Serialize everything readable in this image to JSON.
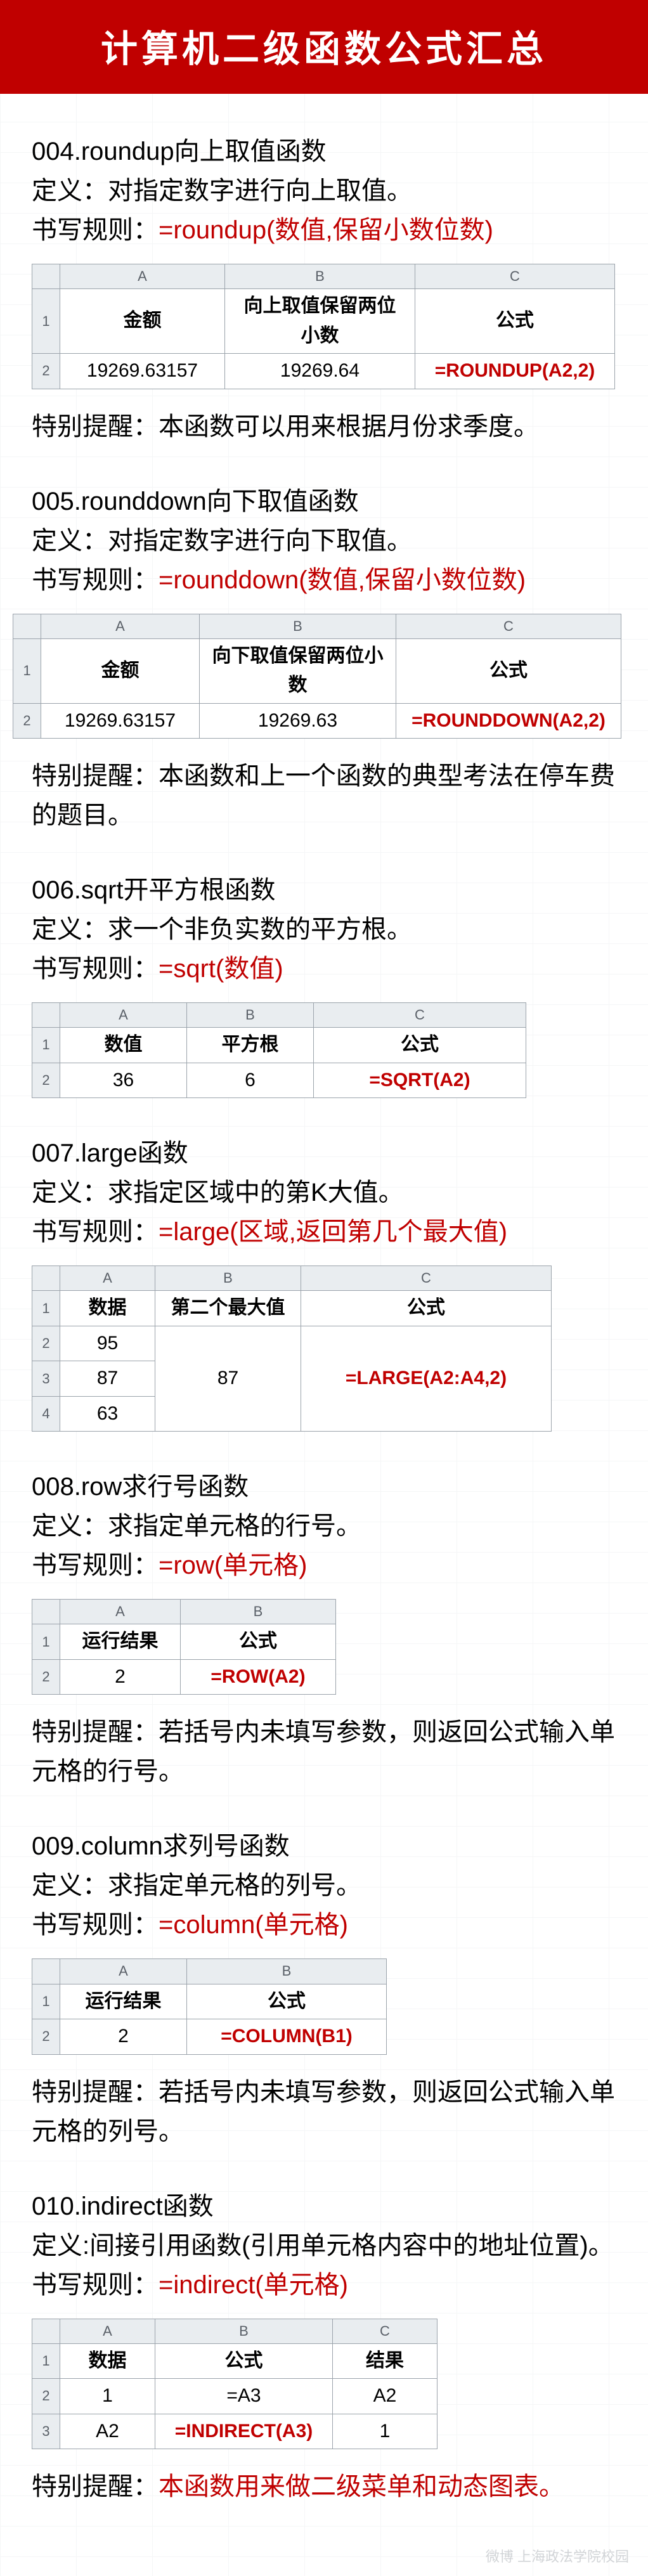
{
  "title": "计算机二级函数公式汇总",
  "watermark": "微博 上海政法学院校园",
  "sections": {
    "s004": {
      "heading": "004.roundup向上取值函数",
      "definition": "定义：对指定数字进行向上取值。",
      "syntax_label": "书写规则：",
      "syntax_formula": "=roundup(数值,保留小数位数)",
      "table_cols": [
        "A",
        "B",
        "C"
      ],
      "header": [
        "金额",
        "向上取值保留两位小数",
        "公式"
      ],
      "row": [
        "19269.63157",
        "19269.64",
        "=ROUNDUP(A2,2)"
      ],
      "tip_label": "特别提醒：",
      "tip_text": "本函数可以用来根据月份求季度。"
    },
    "s005": {
      "heading": "005.rounddown向下取值函数",
      "definition": "定义：对指定数字进行向下取值。",
      "syntax_label": "书写规则：",
      "syntax_formula": "=rounddown(数值,保留小数位数)",
      "table_cols": [
        "A",
        "B",
        "C"
      ],
      "header": [
        "金额",
        "向下取值保留两位小数",
        "公式"
      ],
      "row": [
        "19269.63157",
        "19269.63",
        "=ROUNDDOWN(A2,2)"
      ],
      "tip_label": "特别提醒：",
      "tip_text": "本函数和上一个函数的典型考法在停车费的题目。"
    },
    "s006": {
      "heading": "006.sqrt开平方根函数",
      "definition": "定义：求一个非负实数的平方根。",
      "syntax_label": "书写规则：",
      "syntax_formula": "=sqrt(数值)",
      "table_cols": [
        "A",
        "B",
        "C"
      ],
      "header": [
        "数值",
        "平方根",
        "公式"
      ],
      "row": [
        "36",
        "6",
        "=SQRT(A2)"
      ]
    },
    "s007": {
      "heading": "007.large函数",
      "definition": "定义：求指定区域中的第K大值。",
      "syntax_label": "书写规则：",
      "syntax_formula": "=large(区域,返回第几个最大值)",
      "table_cols": [
        "A",
        "B",
        "C"
      ],
      "header": [
        "数据",
        "第二个最大值",
        "公式"
      ],
      "rows": {
        "r2": "95",
        "r3": "87",
        "r4": "63"
      },
      "merged_b": "87",
      "merged_c": "=LARGE(A2:A4,2)"
    },
    "s008": {
      "heading": "008.row求行号函数",
      "definition": "定义：求指定单元格的行号。",
      "syntax_label": "书写规则：",
      "syntax_formula": "=row(单元格)",
      "table_cols": [
        "A",
        "B"
      ],
      "header": [
        "运行结果",
        "公式"
      ],
      "row": [
        "2",
        "=ROW(A2)"
      ],
      "tip_label": " 特别提醒：",
      "tip_text": "若括号内未填写参数，则返回公式输入单元格的行号。"
    },
    "s009": {
      "heading": "009.column求列号函数",
      "definition": "定义：求指定单元格的列号。",
      "syntax_label": "书写规则：",
      "syntax_formula": "=column(单元格)",
      "table_cols": [
        "A",
        "B"
      ],
      "header": [
        "运行结果",
        "公式"
      ],
      "row": [
        "2",
        "=COLUMN(B1)"
      ],
      "tip_label": "特别提醒：",
      "tip_text": "若括号内未填写参数，则返回公式输入单元格的列号。"
    },
    "s010": {
      "heading": "010.indirect函数",
      "definition": "定义:间接引用函数(引用单元格内容中的地址位置)。",
      "syntax_label": "书写规则：",
      "syntax_formula": "=indirect(单元格)",
      "table_cols": [
        "A",
        "B",
        "C"
      ],
      "header": [
        "数据",
        "公式",
        "结果"
      ],
      "row2": [
        "1",
        "=A3",
        "A2"
      ],
      "row3": [
        "A2",
        "=INDIRECT(A3)",
        "1"
      ],
      "tip_label": "特别提醒：",
      "tip_text": "本函数用来做二级菜单和动态图表。"
    },
    "rowlabels": {
      "r1": "1",
      "r2": "2",
      "r3": "3",
      "r4": "4"
    }
  }
}
